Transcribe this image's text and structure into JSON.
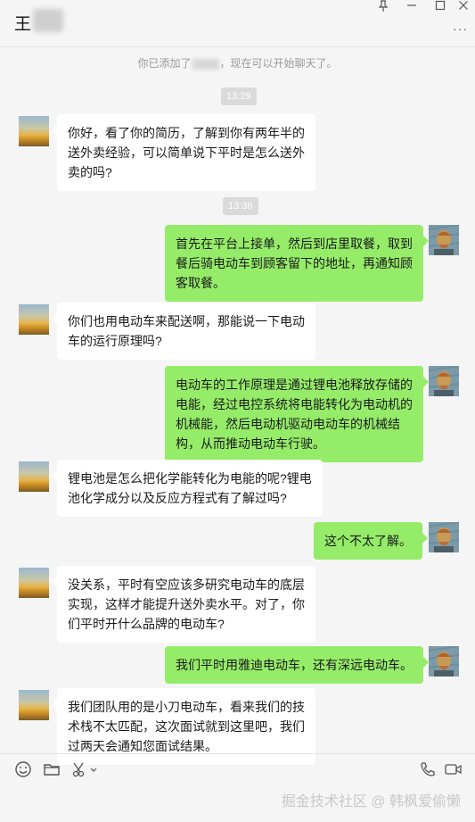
{
  "header": {
    "contact_name": "王",
    "more_icon": "more-icon",
    "window_controls": [
      "pin-icon",
      "minimize-icon",
      "maximize-icon",
      "close-icon"
    ]
  },
  "system": {
    "added_notice_prefix": "你已添加了",
    "added_notice_suffix": "，现在可以开始聊天了。",
    "times": [
      "13:29",
      "13:36"
    ]
  },
  "messages": [
    {
      "side": "left",
      "lines": [
        "你好，看了你的简历，了解到你有两年半的",
        "送外卖经验，可以简单说下平时是怎么送外",
        "卖的吗?"
      ]
    },
    {
      "side": "right",
      "lines": [
        "首先在平台上接单，然后到店里取餐，取到",
        "餐后骑电动车到顾客留下的地址，再通知顾",
        "客取餐。"
      ]
    },
    {
      "side": "left",
      "lines": [
        "你们也用电动车来配送啊，那能说一下电动",
        "车的运行原理吗?"
      ]
    },
    {
      "side": "right",
      "lines": [
        "电动车的工作原理是通过锂电池释放存储的",
        "电能，经过电控系统将电能转化为电动机的",
        "机械能，然后电动机驱动电动车的机械结",
        "构，从而推动电动车行驶。"
      ]
    },
    {
      "side": "left",
      "lines": [
        "锂电池是怎么把化学能转化为电能的呢?锂电",
        "池化学成分以及反应方程式有了解过吗?"
      ]
    },
    {
      "side": "right",
      "lines": [
        "这个不太了解。"
      ]
    },
    {
      "side": "left",
      "lines": [
        "没关系，平时有空应该多研究电动车的底层",
        "实现，这样才能提升送外卖水平。对了，你",
        "们平时开什么品牌的电动车?"
      ]
    },
    {
      "side": "right",
      "lines": [
        "我们平时用雅迪电动车，还有深远电动车。"
      ]
    },
    {
      "side": "left",
      "lines": [
        "我们团队用的是小刀电动车，看来我们的技",
        "术栈不太匹配，这次面试就到这里吧，我们",
        "过两天会通知您面试结果。"
      ]
    }
  ],
  "toolbar": {
    "left_icons": [
      "emoji-icon",
      "folder-icon",
      "scissors-icon",
      "chevron-down-icon"
    ],
    "right_icons": [
      "phone-icon",
      "video-icon"
    ]
  },
  "watermark": "掘金技术社区 @ 韩枫爱偷懒",
  "colors": {
    "background": "#f5f5f5",
    "bubble_left": "#ffffff",
    "bubble_right": "#95ec69"
  }
}
